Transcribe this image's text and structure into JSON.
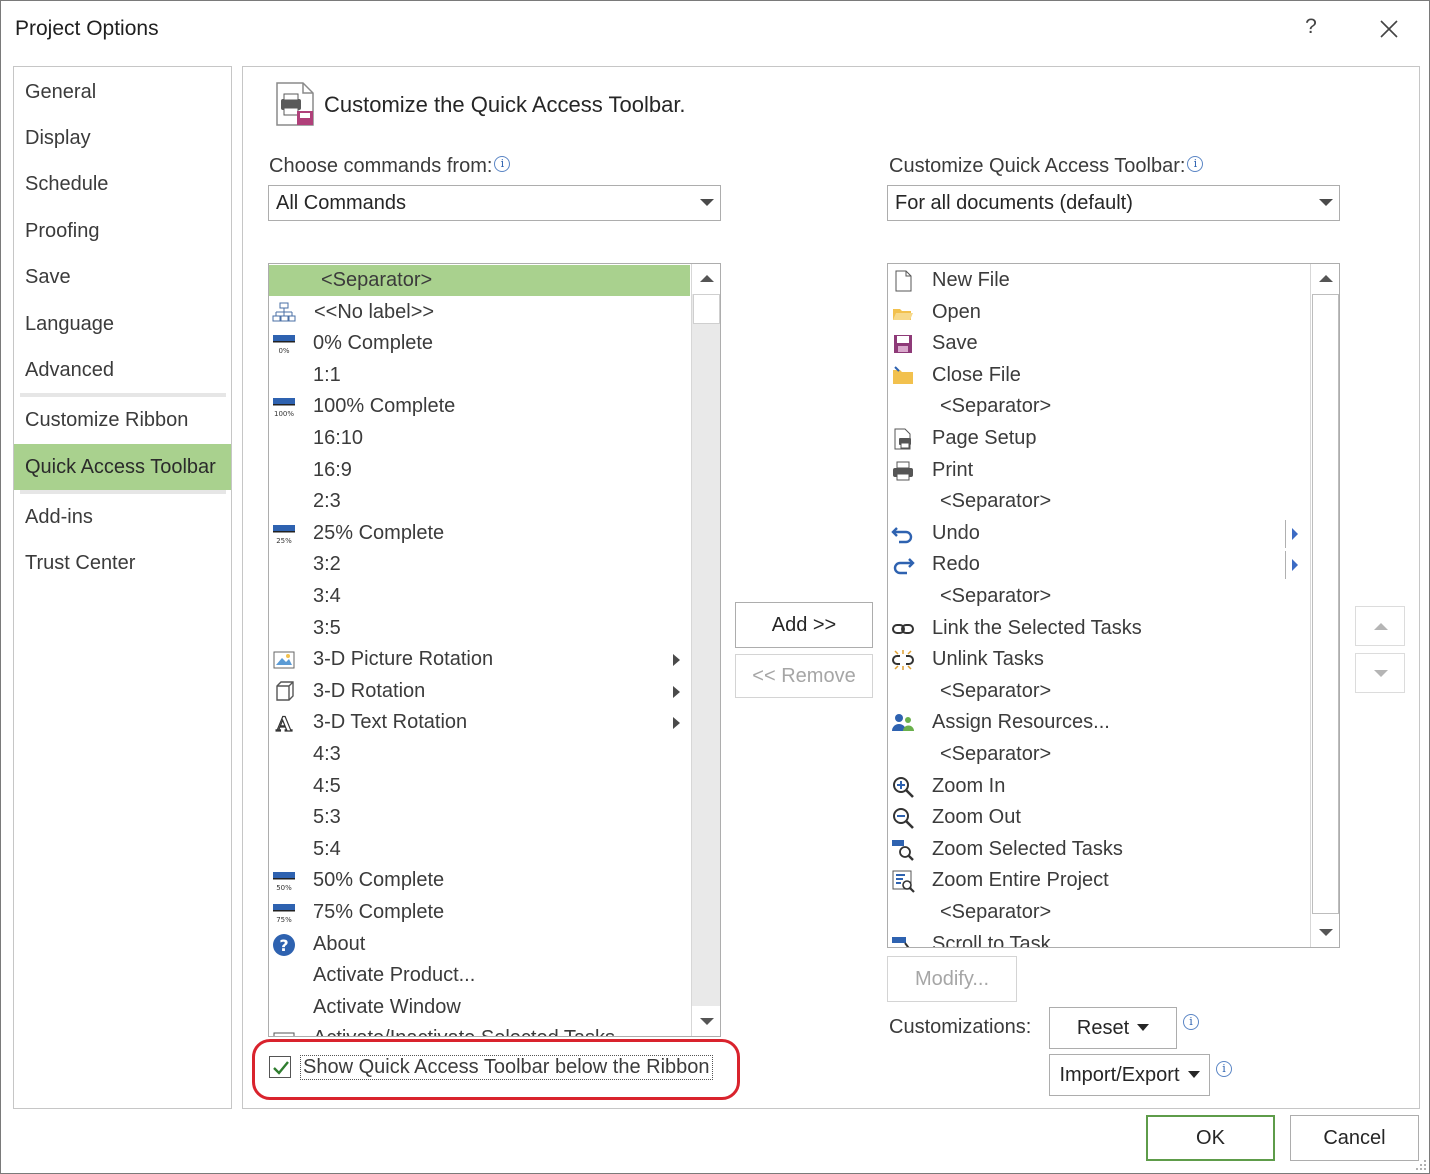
{
  "window": {
    "title": "Project Options",
    "help_label": "?"
  },
  "nav": {
    "items": [
      {
        "label": "General"
      },
      {
        "label": "Display"
      },
      {
        "label": "Schedule"
      },
      {
        "label": "Proofing"
      },
      {
        "label": "Save"
      },
      {
        "label": "Language"
      },
      {
        "label": "Advanced"
      },
      {
        "label": "Customize Ribbon"
      },
      {
        "label": "Quick Access Toolbar",
        "selected": true
      },
      {
        "label": "Add-ins"
      },
      {
        "label": "Trust Center"
      }
    ]
  },
  "main": {
    "heading": "Customize the Quick Access Toolbar.",
    "choose_label": "Choose commands from:",
    "choose_value": "All Commands",
    "customize_label": "Customize Quick Access Toolbar:",
    "customize_value": "For all documents (default)",
    "info_glyph": "i"
  },
  "commands": [
    {
      "label": "<Separator>",
      "icon": "none",
      "selected": true
    },
    {
      "label": "<<No label>>",
      "icon": "org-chart-icon"
    },
    {
      "label": "0% Complete",
      "icon": "progress-0-icon",
      "icon_text": "0%"
    },
    {
      "label": "1:1",
      "icon": "none"
    },
    {
      "label": "100% Complete",
      "icon": "progress-100-icon",
      "icon_text": "100%"
    },
    {
      "label": "16:10",
      "icon": "none"
    },
    {
      "label": "16:9",
      "icon": "none"
    },
    {
      "label": "2:3",
      "icon": "none"
    },
    {
      "label": "25% Complete",
      "icon": "progress-25-icon",
      "icon_text": "25%"
    },
    {
      "label": "3:2",
      "icon": "none"
    },
    {
      "label": "3:4",
      "icon": "none"
    },
    {
      "label": "3:5",
      "icon": "none"
    },
    {
      "label": "3-D Picture Rotation",
      "icon": "picture-rotation-icon",
      "submenu": true
    },
    {
      "label": "3-D Rotation",
      "icon": "cube-rotation-icon",
      "submenu": true
    },
    {
      "label": "3-D Text Rotation",
      "icon": "text-rotation-icon",
      "icon_text": "A",
      "submenu": true
    },
    {
      "label": "4:3",
      "icon": "none"
    },
    {
      "label": "4:5",
      "icon": "none"
    },
    {
      "label": "5:3",
      "icon": "none"
    },
    {
      "label": "5:4",
      "icon": "none"
    },
    {
      "label": "50% Complete",
      "icon": "progress-50-icon",
      "icon_text": "50%"
    },
    {
      "label": "75% Complete",
      "icon": "progress-75-icon",
      "icon_text": "75%"
    },
    {
      "label": "About",
      "icon": "help-circle-icon",
      "icon_text": "?"
    },
    {
      "label": "Activate Product...",
      "icon": "none"
    },
    {
      "label": "Activate Window",
      "icon": "none"
    },
    {
      "label": "Activate/Inactivate Selected Tasks",
      "icon": "activate-tasks-icon"
    }
  ],
  "toolbar_items": [
    {
      "label": "New File",
      "icon": "new-file-icon"
    },
    {
      "label": "Open",
      "icon": "open-folder-icon"
    },
    {
      "label": "Save",
      "icon": "save-icon"
    },
    {
      "label": "Close File",
      "icon": "close-file-icon"
    },
    {
      "label": "<Separator>",
      "icon": "none",
      "indent": true
    },
    {
      "label": "Page Setup",
      "icon": "page-setup-icon"
    },
    {
      "label": "Print",
      "icon": "printer-icon"
    },
    {
      "label": "<Separator>",
      "icon": "none",
      "indent": true
    },
    {
      "label": "Undo",
      "icon": "undo-icon",
      "split": true
    },
    {
      "label": "Redo",
      "icon": "redo-icon",
      "split": true
    },
    {
      "label": "<Separator>",
      "icon": "none",
      "indent": true
    },
    {
      "label": "Link the Selected Tasks",
      "icon": "link-icon"
    },
    {
      "label": "Unlink Tasks",
      "icon": "unlink-icon"
    },
    {
      "label": "<Separator>",
      "icon": "none",
      "indent": true
    },
    {
      "label": "Assign Resources...",
      "icon": "assign-resources-icon"
    },
    {
      "label": "<Separator>",
      "icon": "none",
      "indent": true
    },
    {
      "label": "Zoom In",
      "icon": "zoom-in-icon"
    },
    {
      "label": "Zoom Out",
      "icon": "zoom-out-icon"
    },
    {
      "label": "Zoom Selected Tasks",
      "icon": "zoom-selected-icon"
    },
    {
      "label": "Zoom Entire Project",
      "icon": "zoom-entire-icon"
    },
    {
      "label": "<Separator>",
      "icon": "none",
      "indent": true
    },
    {
      "label": "Scroll to Task",
      "icon": "scroll-to-task-icon"
    }
  ],
  "buttons": {
    "add": "Add >>",
    "remove": "<< Remove",
    "modify": "Modify...",
    "customizations_label": "Customizations:",
    "reset": "Reset",
    "import_export": "Import/Export",
    "ok": "OK",
    "cancel": "Cancel"
  },
  "checkbox": {
    "label": "Show Quick Access Toolbar below the Ribbon",
    "checked": true
  },
  "colors": {
    "selection": "#a9d18e",
    "highlight_ring": "#d9232d",
    "accent_blue": "#2e62b0"
  }
}
